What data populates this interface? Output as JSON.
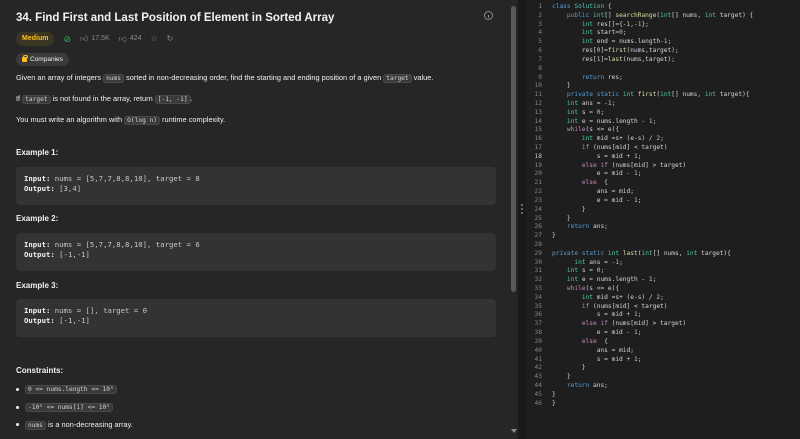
{
  "problem": {
    "title": "34. Find First and Last Position of Element in Sorted Array",
    "difficulty": "Medium",
    "likes": "17.5K",
    "dislikes": "424",
    "companies_label": "Companies",
    "desc1_a": "Given an array of integers ",
    "desc1_code1": "nums",
    "desc1_b": " sorted in non-decreasing order, find the starting and ending position of a given ",
    "desc1_code2": "target",
    "desc1_c": " value.",
    "desc2_a": "If ",
    "desc2_code1": "target",
    "desc2_b": " is not found in the array, return ",
    "desc2_code2": "[-1, -1]",
    "desc2_c": ".",
    "desc3_a": "You must write an algorithm with ",
    "desc3_code": "O(log n)",
    "desc3_b": " runtime complexity."
  },
  "examples": [
    {
      "heading": "Example 1:",
      "input_label": "Input:",
      "input": " nums = [5,7,7,8,8,10], target = 8",
      "output_label": "Output:",
      "output": " [3,4]"
    },
    {
      "heading": "Example 2:",
      "input_label": "Input:",
      "input": " nums = [5,7,7,8,8,10], target = 6",
      "output_label": "Output:",
      "output": " [-1,-1]"
    },
    {
      "heading": "Example 3:",
      "input_label": "Input:",
      "input": " nums = [], target = 0",
      "output_label": "Output:",
      "output": " [-1,-1]"
    }
  ],
  "constraints": {
    "heading": "Constraints:",
    "c1": "0 <= nums.length <= 10⁵",
    "c2": "-10⁹ <= nums[i] <= 10⁹",
    "c3_code": "nums",
    "c3_text": " is a non-decreasing array."
  },
  "code_lines": [
    "class Solution {",
    "    public int[] searchRange(int[] nums, int target) {",
    "        int res[]={-1,-1};",
    "        int start=0;",
    "        int end = nums.length-1;",
    "        res[0]=first(nums,target);",
    "        res[1]=last(nums,target);",
    "",
    "        return res;",
    "    }",
    "    private static int first(int[] nums, int target){",
    "    int ans = -1;",
    "    int s = 0;",
    "    int e = nums.length - 1;",
    "    while(s <= e){",
    "        int mid =s+ (e-s) / 2;",
    "        if (nums[mid] < target)",
    "            s = mid + 1;",
    "        else if (nums[mid] > target)",
    "            e = mid - 1;",
    "        else  {",
    "            ans = mid;",
    "            e = mid - 1;",
    "        }",
    "    }",
    "    return ans;",
    "}",
    "",
    "private static int last(int[] nums, int target){",
    "      int ans = -1;",
    "    int s = 0;",
    "    int e = nums.length - 1;",
    "    while(s <= e){",
    "        int mid =s+ (e-s) / 2;",
    "        if (nums[mid] < target)",
    "            s = mid + 1;",
    "        else if (nums[mid] > target)",
    "            e = mid - 1;",
    "        else  {",
    "            ans = mid;",
    "            s = mid + 1;",
    "        }",
    "    }",
    "    return ans;",
    "}",
    "}"
  ],
  "colors": {
    "medium": "#ffc01e",
    "accepted": "#2db55d",
    "keyword": "#569cd6",
    "type": "#4ec9b0",
    "function": "#dcdcaa"
  }
}
